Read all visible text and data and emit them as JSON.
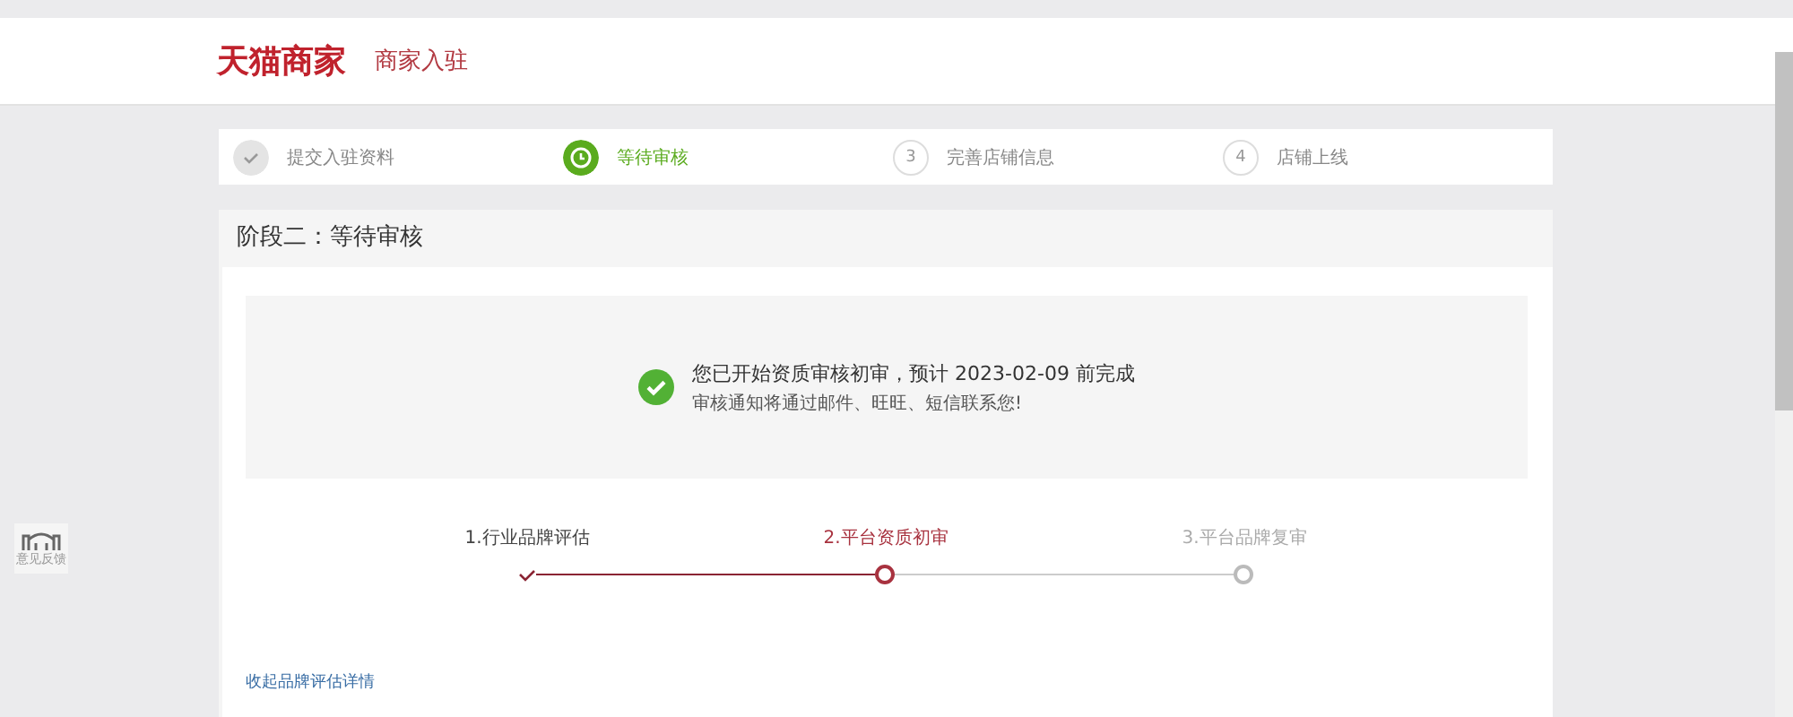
{
  "header": {
    "logo": "天猫商家",
    "subtitle": "商家入驻"
  },
  "steps": [
    {
      "label": "提交入驻资料",
      "completed": true,
      "selected": false
    },
    {
      "label": "等待审核",
      "completed": false,
      "selected": true
    },
    {
      "number": "3",
      "label": "完善店铺信息",
      "completed": false,
      "selected": false
    },
    {
      "number": "4",
      "label": "店铺上线",
      "completed": false,
      "selected": false
    }
  ],
  "panel": {
    "title": "阶段二：等待审核",
    "notice": {
      "title": "您已开始资质审核初审，预计 2023-02-09 前完成",
      "text": "审核通知将通过邮件、旺旺、短信联系您!"
    },
    "substeps": [
      {
        "label": "1.行业品牌评估",
        "completed": true,
        "selected": false
      },
      {
        "label": "2.平台资质初审",
        "completed": false,
        "selected": true
      },
      {
        "label": "3.平台品牌复审",
        "completed": false,
        "selected": false
      }
    ],
    "link": "收起品牌评估详情"
  },
  "float_widget": {
    "label": "意见反馈"
  }
}
